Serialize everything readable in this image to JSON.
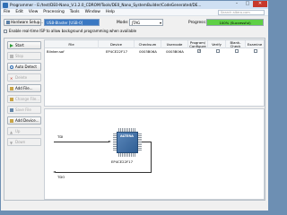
{
  "window": {
    "title": "Programmer - E:/test/DE0-Nano_V.1.2.0_CDROM/Tools/DE0_Nano_SystemBuilder/CodeGenerated/DE...",
    "min": "–",
    "max": "□",
    "close": "✕"
  },
  "menu": [
    "File",
    "Edit",
    "View",
    "Processing",
    "Tools",
    "Window",
    "Help"
  ],
  "help_search_placeholder": "Search altera.com",
  "toolbar": {
    "hardware_setup_label": "Hardware Setup...",
    "hardware_value": "USB-Blaster [USB-0]",
    "mode_label": "Mode:",
    "mode_value": "JTAG",
    "progress_label": "Progress:",
    "progress_text": "100% (Successful)",
    "progress_percent": 100,
    "isp_label": "Enable real-time ISP to allow background programming when available",
    "isp_checked": false
  },
  "sidebar": [
    {
      "label": "Start",
      "enabled": true,
      "icon": "start-icon"
    },
    {
      "label": "Stop",
      "enabled": false,
      "icon": "stop-icon"
    },
    {
      "label": "Auto Detect",
      "enabled": true,
      "icon": "auto-detect-icon"
    },
    {
      "label": "Delete",
      "enabled": false,
      "icon": "delete-icon"
    },
    {
      "label": "Add File...",
      "enabled": true,
      "icon": "add-file-icon"
    },
    {
      "label": "Change File...",
      "enabled": false,
      "icon": "change-file-icon"
    },
    {
      "label": "Save File",
      "enabled": false,
      "icon": "save-file-icon"
    },
    {
      "label": "Add Device...",
      "enabled": true,
      "icon": "add-device-icon"
    },
    {
      "label": "Up",
      "enabled": false,
      "icon": "up-icon"
    },
    {
      "label": "Down",
      "enabled": false,
      "icon": "down-icon"
    }
  ],
  "table": {
    "headers": [
      "File",
      "Device",
      "Checksum",
      "Usercode",
      "Program/\nConfigure",
      "Verify",
      "Blank-\nCheck",
      "Examine"
    ],
    "rows": [
      {
        "file": "Blinker.sof",
        "device": "EP4CE22F17",
        "checksum": "0003B06A",
        "usercode": "0003B06A",
        "program": true,
        "verify": false,
        "blank_check": false,
        "examine": false
      }
    ]
  },
  "diagram": {
    "tdi_label": "TDI",
    "tdo_label": "TDO",
    "chip_label": "EP4CE22F17",
    "chip_logo": "ALTERA"
  },
  "colors": {
    "progress_fill": "#5fd046",
    "hw_field": "#3a78c2",
    "close": "#c7382a"
  }
}
